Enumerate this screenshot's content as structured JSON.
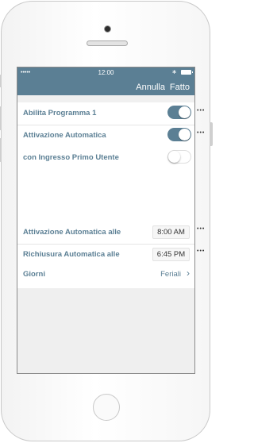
{
  "status_bar": {
    "signal": "•••••",
    "time": "12:00",
    "bluetooth": "∗"
  },
  "nav_bar": {
    "cancel_label": "Annulla",
    "done_label": "Fatto"
  },
  "settings": [
    {
      "label": "Abilita Programma 1",
      "toggle": "on"
    },
    {
      "label": "Attivazione Automatica",
      "toggle": "on"
    },
    {
      "label": "con Ingresso Primo Utente",
      "toggle": "off"
    }
  ],
  "schedule": {
    "activation_label": "Attivazione Automatica alle",
    "activation_time": "8:00 AM",
    "closing_label": "Richiusura Automatica alle",
    "closing_time": "6:45 PM",
    "days_label": "Giorni",
    "days_value": "Feriali",
    "chevron_icon": "chevron-right-icon"
  },
  "colors": {
    "accent": "#5b7f94",
    "screen_background": "#efefef"
  }
}
